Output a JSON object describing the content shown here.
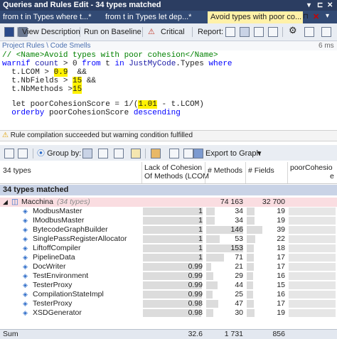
{
  "window": {
    "title": "Queries and Rules Edit  - 34 types matched"
  },
  "tabs": [
    {
      "label": "from t in Types where t...*"
    },
    {
      "label": "from t in Types let dep...*"
    },
    {
      "label": "Avoid types with poor co..."
    }
  ],
  "toolbar": {
    "view_description": "View Description",
    "run_on_baseline": "Run on Baseline",
    "critical": "Critical",
    "report": "Report:"
  },
  "breadcrumb": {
    "path": "Project Rules \\ Code Smells",
    "time": "6 ms"
  },
  "code": {
    "l1": "// <Name>Avoid types with poor cohesion</Name>",
    "l2a": "warnif ",
    "l2b": "count",
    "l2c": " > ",
    "l2d": "0",
    "l2e": " from ",
    "l2f": "t",
    "l2g": " in ",
    "l2h": "JustMyCode",
    "l2i": ".Types ",
    "l2j": "where",
    "l3a": "  t.LCOM > ",
    "l3b": "0.9",
    "l3c": "  &&",
    "l4a": "  t.NbFields > ",
    "l4b": "15",
    "l4c": " &&",
    "l5a": "  t.NbMethods >",
    "l5b": "15",
    "l6a": "  let poorCohesionScore = 1/(",
    "l6b": "1.01",
    "l6c": " - t.LCOM)",
    "l7a": "  orderby",
    "l7b": " poorCohesionScore ",
    "l7c": "descending"
  },
  "status": {
    "message": "Rule compilation succeeded but warning condition fulfilled"
  },
  "grid_toolbar": {
    "group_by": "Group by:",
    "export": "Export to Graph"
  },
  "columns": {
    "count": "34 types",
    "lcom_1": "Lack of Cohesion",
    "lcom_2": "Of Methods (LCOM",
    "methods": "# Methods",
    "fields": "# Fields",
    "poor_1": "poorCohesio",
    "poor_2": "e"
  },
  "group": {
    "label": "34 types matched"
  },
  "namespace": {
    "name": "Macchina",
    "count": "(34 types)",
    "methods": "74 163",
    "fields": "32 700"
  },
  "rows": [
    {
      "name": "ModbusMaster",
      "lcom": "1",
      "lcom_frac": 1.0,
      "methods": "34",
      "methods_frac": 0.23,
      "fields": "19",
      "fields_frac": 0.2
    },
    {
      "name": "IModbusMaster",
      "lcom": "1",
      "lcom_frac": 1.0,
      "methods": "34",
      "methods_frac": 0.23,
      "fields": "19",
      "fields_frac": 0.2
    },
    {
      "name": "BytecodeGraphBuilder",
      "lcom": "1",
      "lcom_frac": 1.0,
      "methods": "146",
      "methods_frac": 1.0,
      "fields": "39",
      "fields_frac": 0.4
    },
    {
      "name": "SinglePassRegisterAllocator",
      "lcom": "1",
      "lcom_frac": 1.0,
      "methods": "53",
      "methods_frac": 0.36,
      "fields": "22",
      "fields_frac": 0.23
    },
    {
      "name": "LiftoffCompiler",
      "lcom": "1",
      "lcom_frac": 1.0,
      "methods": "153",
      "methods_frac": 1.0,
      "fields": "18",
      "fields_frac": 0.19
    },
    {
      "name": "PipelineData",
      "lcom": "1",
      "lcom_frac": 1.0,
      "methods": "71",
      "methods_frac": 0.48,
      "fields": "17",
      "fields_frac": 0.18
    },
    {
      "name": "DocWriter",
      "lcom": "0.99",
      "lcom_frac": 0.99,
      "methods": "21",
      "methods_frac": 0.14,
      "fields": "17",
      "fields_frac": 0.18
    },
    {
      "name": "TestEnvironment",
      "lcom": "0.99",
      "lcom_frac": 0.99,
      "methods": "29",
      "methods_frac": 0.2,
      "fields": "16",
      "fields_frac": 0.17
    },
    {
      "name": "TesterProxy",
      "lcom": "0.99",
      "lcom_frac": 0.99,
      "methods": "44",
      "methods_frac": 0.3,
      "fields": "15",
      "fields_frac": 0.16
    },
    {
      "name": "CompilationStateImpl",
      "lcom": "0.99",
      "lcom_frac": 0.99,
      "methods": "25",
      "methods_frac": 0.17,
      "fields": "16",
      "fields_frac": 0.17
    },
    {
      "name": "TesterProxy",
      "lcom": "0.98",
      "lcom_frac": 0.98,
      "methods": "47",
      "methods_frac": 0.32,
      "fields": "17",
      "fields_frac": 0.18
    },
    {
      "name": "XSDGenerator",
      "lcom": "0.98",
      "lcom_frac": 0.98,
      "methods": "30",
      "methods_frac": 0.2,
      "fields": "19",
      "fields_frac": 0.2
    }
  ],
  "sum": {
    "label": "Sum",
    "lcom": "32.6",
    "methods": "1 731",
    "fields": "856"
  },
  "colors": {
    "title": "#2b3d61",
    "tab_active": "#fff1a8",
    "highlight": "#fff200",
    "namespace_row": "#fadde1"
  }
}
